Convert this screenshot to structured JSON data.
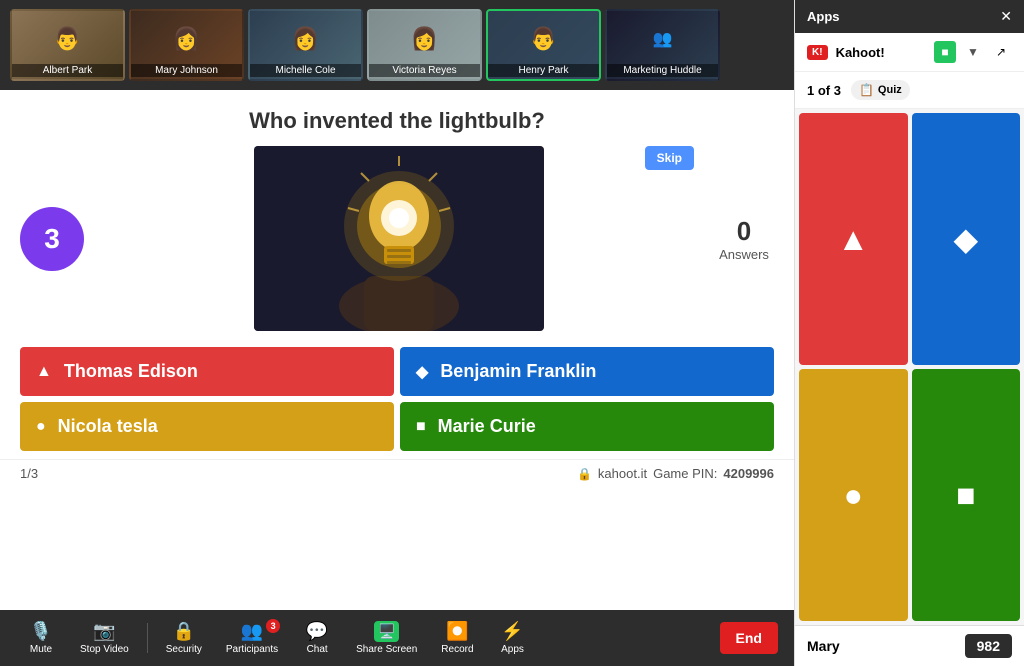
{
  "apps_panel": {
    "title": "Apps",
    "close_label": "✕"
  },
  "kahoot_panel": {
    "logo": "K!",
    "name": "Kahoot!",
    "chevron": "▾",
    "green_icon": "■",
    "filter_icon": "▼",
    "external_icon": "↗"
  },
  "quiz_status": {
    "counter": "1 of 3",
    "badge_icon": "📋",
    "badge_label": "Quiz"
  },
  "question": {
    "text": "Who invented the lightbulb?",
    "timer": "3",
    "skip_label": "Skip",
    "answers_count": "0",
    "answers_label": "Answers"
  },
  "answer_options": [
    {
      "id": "a1",
      "label": "Thomas Edison",
      "color": "red",
      "shape": "▲"
    },
    {
      "id": "a2",
      "label": "Benjamin Franklin",
      "color": "blue",
      "shape": "◆"
    },
    {
      "id": "a3",
      "label": "Nicola tesla",
      "color": "yellow",
      "shape": "●"
    },
    {
      "id": "a4",
      "label": "Marie Curie",
      "color": "green",
      "shape": "■"
    }
  ],
  "footer": {
    "page": "1/3",
    "lock_icon": "🔒",
    "site": "kahoot.it",
    "game_pin_label": "Game PIN:",
    "game_pin": "4209996"
  },
  "participants": [
    {
      "name": "Albert Park",
      "active": false,
      "emoji": "👨"
    },
    {
      "name": "Mary Johnson",
      "active": false,
      "emoji": "👩"
    },
    {
      "name": "Michelle Cole",
      "active": false,
      "emoji": "👩‍💼"
    },
    {
      "name": "Victoria Reyes",
      "active": false,
      "emoji": "👩"
    },
    {
      "name": "Henry Park",
      "active": true,
      "emoji": "👨"
    },
    {
      "name": "Marketing Huddle",
      "active": false,
      "emoji": "👥"
    }
  ],
  "toolbar": {
    "items": [
      {
        "icon": "🎙️",
        "label": "Mute",
        "chevron": "^"
      },
      {
        "icon": "📷",
        "label": "Stop Video",
        "chevron": "^"
      },
      {
        "icon": "🔒",
        "label": "Security"
      },
      {
        "icon": "👥",
        "label": "Participants",
        "badge": "3"
      },
      {
        "icon": "💬",
        "label": "Chat"
      },
      {
        "icon": "🖥️",
        "label": "Share Screen",
        "active": true
      },
      {
        "icon": "⏺️",
        "label": "Record"
      },
      {
        "icon": "⚡",
        "label": "Apps"
      }
    ],
    "end_label": "End"
  },
  "score": {
    "name": "Mary",
    "value": "982"
  },
  "tile_shapes": {
    "triangle": "▲",
    "diamond": "◆",
    "circle": "●",
    "square": "■"
  }
}
